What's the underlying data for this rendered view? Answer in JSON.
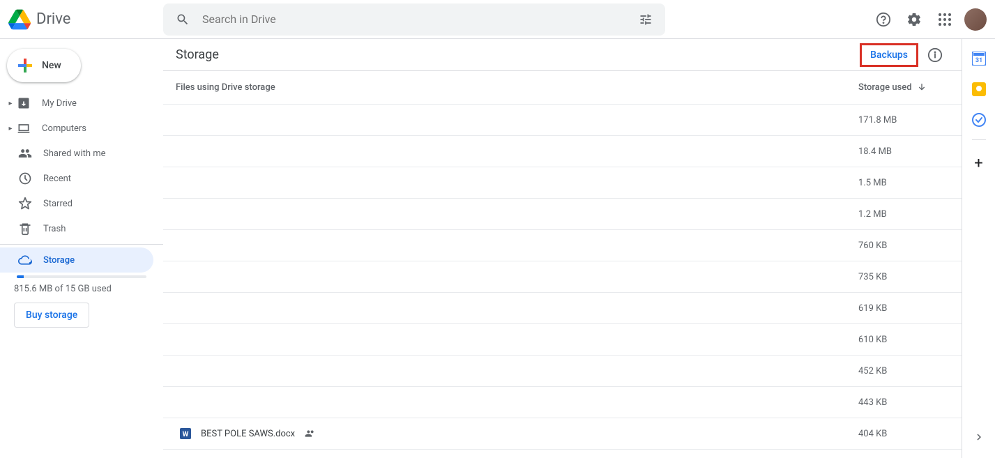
{
  "header": {
    "app_title": "Drive",
    "search_placeholder": "Search in Drive"
  },
  "sidebar": {
    "new_label": "New",
    "items": [
      {
        "label": "My Drive",
        "expandable": true
      },
      {
        "label": "Computers",
        "expandable": true
      },
      {
        "label": "Shared with me",
        "expandable": false
      },
      {
        "label": "Recent",
        "expandable": false
      },
      {
        "label": "Starred",
        "expandable": false
      },
      {
        "label": "Trash",
        "expandable": false
      }
    ],
    "storage_label": "Storage",
    "storage_used_text": "815.6 MB of 15 GB used",
    "storage_used_pct": 5.3,
    "buy_label": "Buy storage"
  },
  "main": {
    "title": "Storage",
    "backups_label": "Backups",
    "columns": {
      "files": "Files using Drive storage",
      "storage": "Storage used"
    },
    "rows": [
      {
        "name": "",
        "size": "171.8 MB",
        "type": ""
      },
      {
        "name": "",
        "size": "18.4 MB",
        "type": ""
      },
      {
        "name": "",
        "size": "1.5 MB",
        "type": ""
      },
      {
        "name": "",
        "size": "1.2 MB",
        "type": ""
      },
      {
        "name": "",
        "size": "760 KB",
        "type": ""
      },
      {
        "name": "",
        "size": "735 KB",
        "type": ""
      },
      {
        "name": "",
        "size": "619 KB",
        "type": ""
      },
      {
        "name": "",
        "size": "610 KB",
        "type": ""
      },
      {
        "name": "",
        "size": "452 KB",
        "type": ""
      },
      {
        "name": "",
        "size": "443 KB",
        "type": ""
      },
      {
        "name": "BEST POLE SAWS.docx",
        "size": "404 KB",
        "type": "docx",
        "shared": true
      }
    ]
  }
}
